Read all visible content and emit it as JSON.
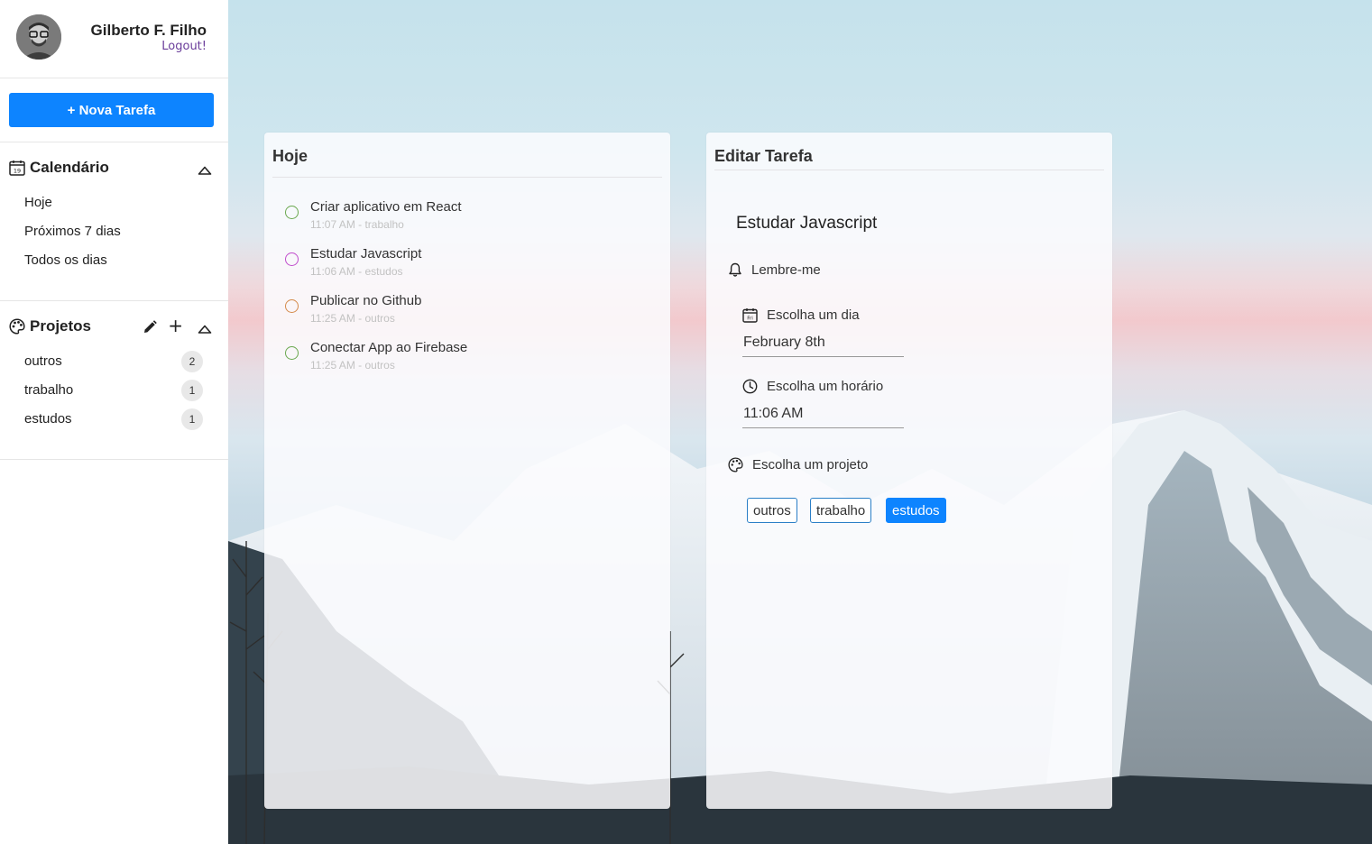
{
  "user": {
    "name": "Gilberto F. Filho",
    "logout_label": "Logout!"
  },
  "new_task_label": "+ Nova Tarefa",
  "calendar": {
    "title": "Calendário",
    "icon": "calendar-icon",
    "icon_text": "19",
    "items": [
      "Hoje",
      "Próximos 7 dias",
      "Todos os dias"
    ]
  },
  "projects": {
    "title": "Projetos",
    "icon": "palette-icon",
    "items": [
      {
        "name": "outros",
        "count": "2"
      },
      {
        "name": "trabalho",
        "count": "1"
      },
      {
        "name": "estudos",
        "count": "1"
      }
    ]
  },
  "today_panel": {
    "title": "Hoje",
    "tasks": [
      {
        "title": "Criar aplicativo em React",
        "meta": "11:07 AM - trabalho",
        "color": "#6aa84f"
      },
      {
        "title": "Estudar Javascript",
        "meta": "11:06 AM - estudos",
        "color": "#c04ccc"
      },
      {
        "title": "Publicar no Github",
        "meta": "11:25 AM - outros",
        "color": "#d48a4a"
      },
      {
        "title": "Conectar App ao Firebase",
        "meta": "11:25 AM - outros",
        "color": "#6aa84f"
      }
    ]
  },
  "edit_panel": {
    "title": "Editar Tarefa",
    "task_name": "Estudar Javascript",
    "reminder_label": "Lembre-me",
    "day_label": "Escolha um dia",
    "day_icon_text": "Fri",
    "day_value": "February 8th",
    "time_label": "Escolha um horário",
    "time_value": "11:06 AM",
    "project_label": "Escolha um projeto",
    "project_options": [
      "outros",
      "trabalho",
      "estudos"
    ],
    "selected_project": "estudos"
  },
  "colors": {
    "accent": "#0d84ff",
    "logout": "#6a3d9a"
  }
}
